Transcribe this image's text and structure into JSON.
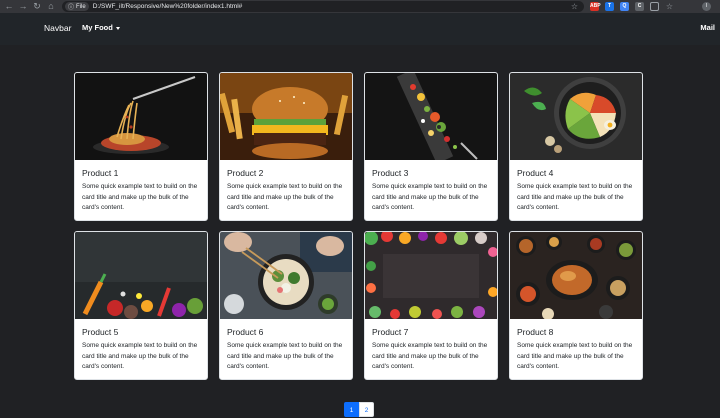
{
  "browser": {
    "site_chip": "File",
    "url": "D:/SWF_ilt/Responsive/New%20folder/index1.html#",
    "profile_initial": "I"
  },
  "navbar": {
    "brand": "Navbar",
    "dropdown": "My Food",
    "mail": "Mail"
  },
  "cards": [
    {
      "title": "Product 1",
      "text": "Some quick example text to build on the card title and make up the bulk of the card's content.",
      "image": "spaghetti-fork"
    },
    {
      "title": "Product 2",
      "text": "Some quick example text to build on the card title and make up the bulk of the card's content.",
      "image": "burger-fries"
    },
    {
      "title": "Product 3",
      "text": "Some quick example text to build on the card title and make up the bulk of the card's content.",
      "image": "flying-salad"
    },
    {
      "title": "Product 4",
      "text": "Some quick example text to build on the card title and make up the bulk of the card's content.",
      "image": "healthy-bowl"
    },
    {
      "title": "Product 5",
      "text": "Some quick example text to build on the card title and make up the bulk of the card's content.",
      "image": "vegetables-spices"
    },
    {
      "title": "Product 6",
      "text": "Some quick example text to build on the card title and make up the bulk of the card's content.",
      "image": "noodle-bowl-chopsticks"
    },
    {
      "title": "Product 7",
      "text": "Some quick example text to build on the card title and make up the bulk of the card's content.",
      "image": "vegetable-frame"
    },
    {
      "title": "Product 8",
      "text": "Some quick example text to build on the card title and make up the bulk of the card's content.",
      "image": "roast-dinner-spread"
    }
  ],
  "pagination": {
    "pages": [
      "1",
      "2"
    ],
    "active": "1"
  },
  "colors": {
    "page_bg": "#202124",
    "navbar_bg": "#212529",
    "accent": "#0d6efd"
  }
}
